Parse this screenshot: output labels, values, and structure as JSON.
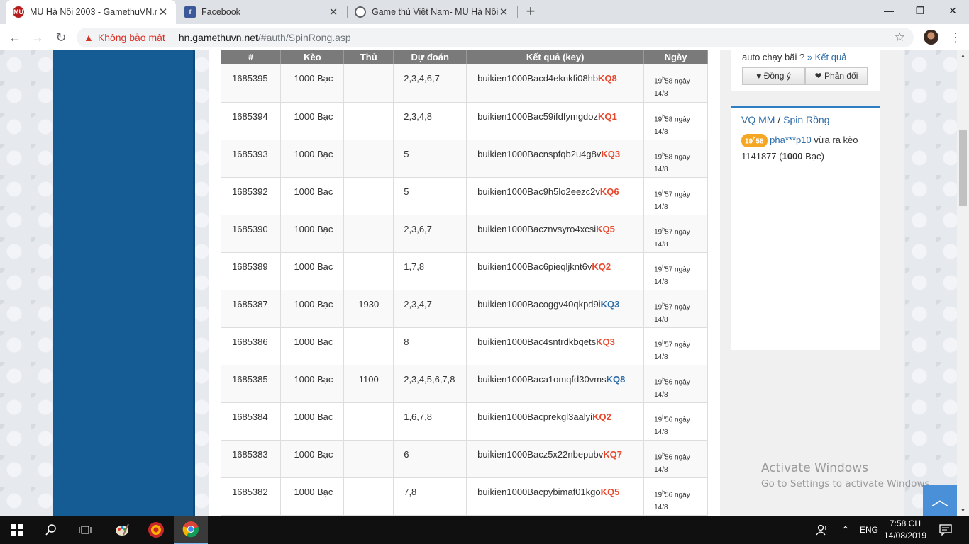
{
  "browser": {
    "tabs": [
      {
        "title": "MU Hà Nội 2003 - GamethuVN.n",
        "active": true
      },
      {
        "title": "Facebook",
        "active": false
      },
      {
        "title": "Game thủ Việt Nam- MU Hà Nội",
        "active": false
      }
    ],
    "security_label": "Không bảo mật",
    "url_host": "hn.gamethuvn.net",
    "url_path": "/#auth/SpinRong.asp"
  },
  "table": {
    "columns": [
      "#",
      "Kèo",
      "Thủ",
      "Dự đoán",
      "Kết quả (key)",
      "Ngày"
    ],
    "rows": [
      {
        "id": "1685395",
        "keo": "1000 Bạc",
        "thu": "",
        "du_doan": "2,3,4,6,7",
        "key": "buikien1000Bacd4eknkfi08hb",
        "kq": "KQ8",
        "hour": "19",
        "time": "58 ngày",
        "date": "14/8"
      },
      {
        "id": "1685394",
        "keo": "1000 Bạc",
        "thu": "",
        "du_doan": "2,3,4,8",
        "key": "buikien1000Bac59ifdfymgdoz",
        "kq": "KQ1",
        "hour": "19",
        "time": "58 ngày",
        "date": "14/8"
      },
      {
        "id": "1685393",
        "keo": "1000 Bạc",
        "thu": "",
        "du_doan": "5",
        "key": "buikien1000Bacnspfqb2u4g8v",
        "kq": "KQ3",
        "hour": "19",
        "time": "58 ngày",
        "date": "14/8"
      },
      {
        "id": "1685392",
        "keo": "1000 Bạc",
        "thu": "",
        "du_doan": "5",
        "key": "buikien1000Bac9h5lo2eezc2v",
        "kq": "KQ6",
        "hour": "19",
        "time": "57 ngày",
        "date": "14/8"
      },
      {
        "id": "1685390",
        "keo": "1000 Bạc",
        "thu": "",
        "du_doan": "2,3,6,7",
        "key": "buikien1000Bacznvsyro4xcsi",
        "kq": "KQ5",
        "hour": "19",
        "time": "57 ngày",
        "date": "14/8"
      },
      {
        "id": "1685389",
        "keo": "1000 Bạc",
        "thu": "",
        "du_doan": "1,7,8",
        "key": "buikien1000Bac6pieqljknt6v",
        "kq": "KQ2",
        "hour": "19",
        "time": "57 ngày",
        "date": "14/8"
      },
      {
        "id": "1685387",
        "keo": "1000 Bạc",
        "thu": "1930",
        "du_doan": "2,3,4,7",
        "key": "buikien1000Bacoggv40qkpd9i",
        "kq": "KQ3",
        "hour": "19",
        "time": "57 ngày",
        "date": "14/8"
      },
      {
        "id": "1685386",
        "keo": "1000 Bạc",
        "thu": "",
        "du_doan": "8",
        "key": "buikien1000Bac4sntrdkbqets",
        "kq": "KQ3",
        "hour": "19",
        "time": "57 ngày",
        "date": "14/8"
      },
      {
        "id": "1685385",
        "keo": "1000 Bạc",
        "thu": "1100",
        "du_doan": "2,3,4,5,6,7,8",
        "key": "buikien1000Baca1omqfd30vms",
        "kq": "KQ8",
        "hour": "19",
        "time": "56 ngày",
        "date": "14/8"
      },
      {
        "id": "1685384",
        "keo": "1000 Bạc",
        "thu": "",
        "du_doan": "1,6,7,8",
        "key": "buikien1000Bacprekgl3aalyi",
        "kq": "KQ2",
        "hour": "19",
        "time": "56 ngày",
        "date": "14/8"
      },
      {
        "id": "1685383",
        "keo": "1000 Bạc",
        "thu": "",
        "du_doan": "6",
        "key": "buikien1000Bacz5x22nbepubv",
        "kq": "KQ7",
        "hour": "19",
        "time": "56 ngày",
        "date": "14/8"
      },
      {
        "id": "1685382",
        "keo": "1000 Bạc",
        "thu": "",
        "du_doan": "7,8",
        "key": "buikien1000Bacpybimaf01kgo",
        "kq": "KQ5",
        "hour": "19",
        "time": "56 ngày",
        "date": "14/8"
      }
    ],
    "kq_colors": {
      "loss": "#e8492e",
      "win": "#2d6ca8"
    }
  },
  "sidebar": {
    "question": "auto chạy bãi ?",
    "result_link": "» Kết quả",
    "agree": "Đồng ý",
    "disagree": "Phản đối",
    "feed_link1": "VQ MM",
    "feed_sep": "/",
    "feed_link2": "Spin Rồng",
    "entry": {
      "hour": "19",
      "minute": "58",
      "user": "pha***p10",
      "text1": "vừa ra kèo",
      "amount_id": "1141877",
      "amount": "1000",
      "currency": "Bạc"
    }
  },
  "watermark": {
    "line1": "Activate Windows",
    "line2": "Go to Settings to activate Windows."
  },
  "taskbar": {
    "lang": "ENG",
    "time": "7:58 CH",
    "date": "14/08/2019"
  }
}
